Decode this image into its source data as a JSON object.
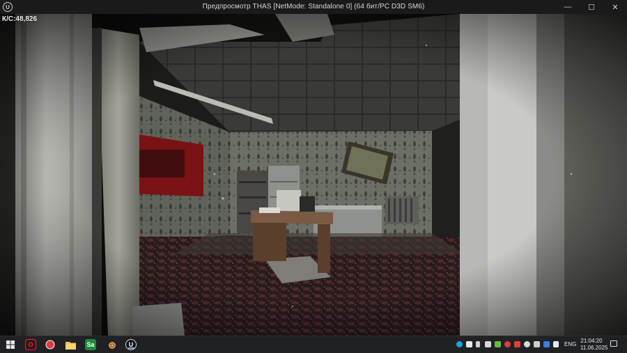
{
  "window": {
    "title": "Предпросмотр THAS [NetMode: Standalone 0]  (64 бит/PC D3D SM6)",
    "logo": "U",
    "controls": {
      "minimize": "—",
      "maximize": "☐",
      "close": "✕"
    }
  },
  "viewport": {
    "fps_label": "К/С:48,826"
  },
  "taskbar": {
    "apps": [
      {
        "name": "windows-start",
        "glyph": ""
      },
      {
        "name": "opera",
        "glyph": "O"
      },
      {
        "name": "record",
        "glyph": "●"
      },
      {
        "name": "file-explorer",
        "glyph": ""
      },
      {
        "name": "sa-app",
        "glyph": "Sa"
      },
      {
        "name": "blender",
        "glyph": ""
      },
      {
        "name": "unreal-engine",
        "glyph": "U"
      }
    ],
    "language": "ENG",
    "time": "21:04:20",
    "date": "11.06.2025"
  }
}
